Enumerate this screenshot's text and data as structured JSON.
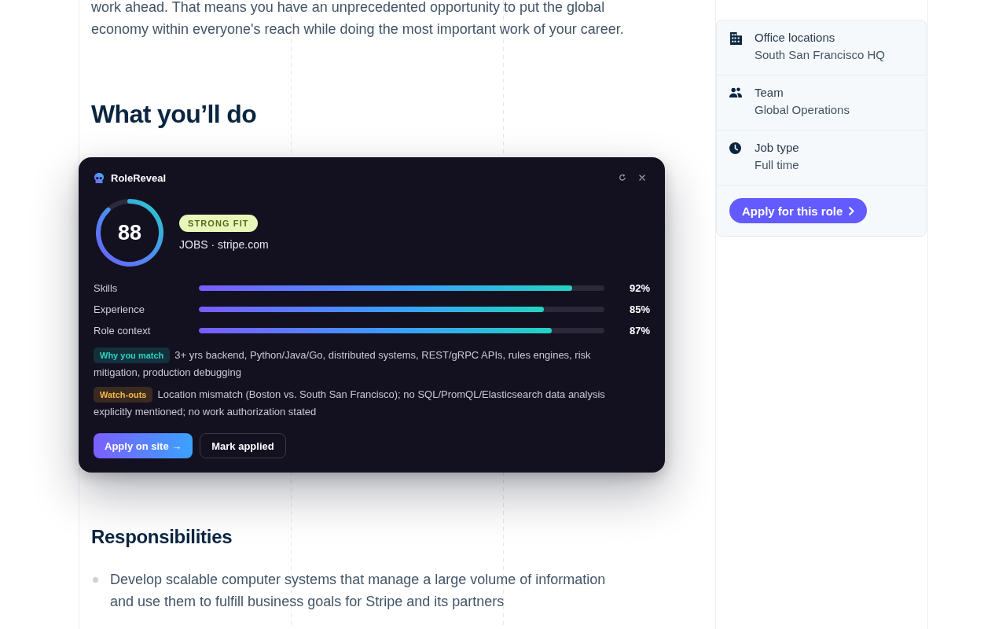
{
  "article": {
    "intro_paragraph": "work ahead. That means you have an unprecedented opportunity to put the global economy within everyone's reach while doing the most important work of your career.",
    "heading": "What you’ll do",
    "subheading": "Responsibilities",
    "responsibilities": [
      "Develop scalable computer systems that manage a large volume of information and use them to fulfill business goals for Stripe and its partners"
    ]
  },
  "sidebar": {
    "details": [
      {
        "kind": "office",
        "label": "Office locations",
        "value": "South San Francisco HQ"
      },
      {
        "kind": "team",
        "label": "Team",
        "value": "Global Operations"
      },
      {
        "kind": "jobtype",
        "label": "Job type",
        "value": "Full time"
      }
    ],
    "apply_button": "Apply for this role"
  },
  "overlay": {
    "title": "RoleReveal",
    "score": "88",
    "score_ring": {
      "level": 0.88
    },
    "fit_badge": "STRONG FIT",
    "source": "JOBS · stripe.com",
    "metrics": [
      {
        "label": "Skills",
        "level": 0.92,
        "reading": "92%"
      },
      {
        "label": "Experience",
        "level": 0.85,
        "reading": "85%"
      },
      {
        "label": "Role context",
        "level": 0.87,
        "reading": "87%"
      }
    ],
    "notes": [
      {
        "kind": "match",
        "tag": "Why you match",
        "text": "3+ yrs backend, Python/Java/Go, distributed systems, REST/gRPC APIs, rules engines, risk mitigation, production debugging"
      },
      {
        "kind": "warning",
        "tag": "Watch-outs",
        "text": "Location mismatch (Boston vs. South San Francisco); no SQL/PromQL/Elasticsearch data analysis explicitly mentioned; no work authorization stated"
      }
    ],
    "buttons": [
      {
        "kind": "primary",
        "label": "Apply on site →"
      },
      {
        "kind": "secondary",
        "label": "Mark applied"
      }
    ]
  }
}
